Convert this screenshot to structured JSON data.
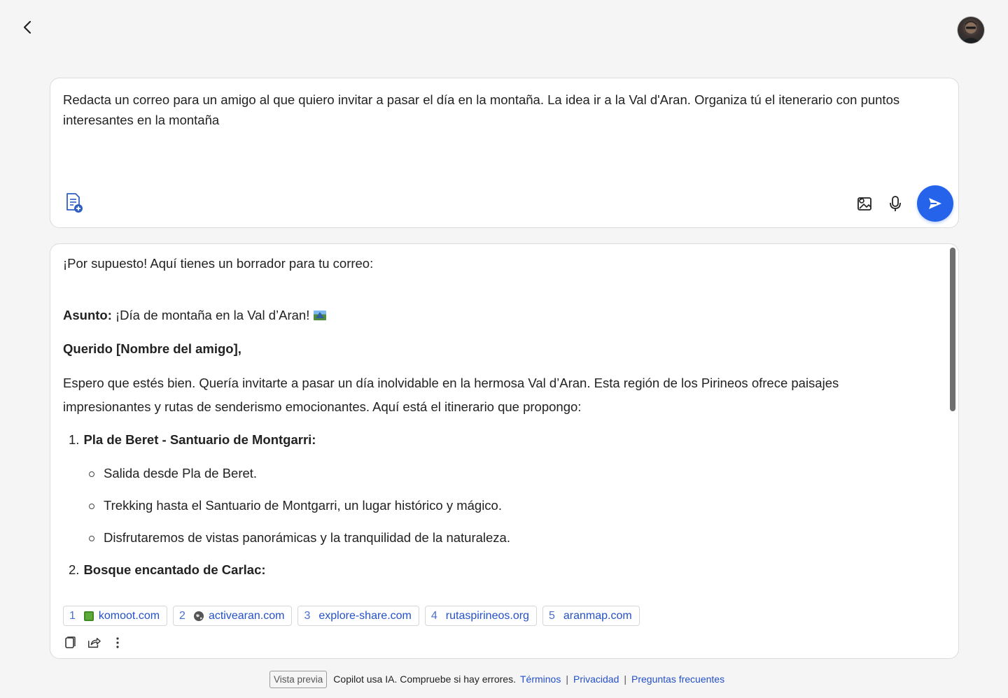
{
  "nav": {
    "back_icon": "chevron-left-icon",
    "avatar_icon": "user-avatar"
  },
  "prompt": {
    "text": "Redacta un correo para un amigo al que quiero invitar a pasar el día en la montaña. La idea ir a la Val d'Aran. Organiza tú el itenerario con puntos interesantes en la montaña",
    "send_color": "#2563eb"
  },
  "response": {
    "intro": "¡Por supuesto! Aquí tienes un borrador para tu correo:",
    "subject_label": "Asunto:",
    "subject_text": "¡Día de montaña en la Val d’Aran!",
    "subject_emoji": "mountain-landscape-emoji",
    "greeting": "Querido [Nombre del amigo],",
    "paragraph": "Espero que estés bien. Quería invitarte a pasar un día inolvidable en la hermosa Val d’Aran. Esta región de los Pirineos ofrece paisajes impresionantes y rutas de senderismo emocionantes. Aquí está el itinerario que propongo:",
    "items": [
      {
        "num": "1.",
        "title": "Pla de Beret - Santuario de Montgarri:",
        "bullets": [
          "Salida desde Pla de Beret.",
          "Trekking hasta el Santuario de Montgarri, un lugar histórico y mágico.",
          "Disfrutaremos de vistas panorámicas y la tranquilidad de la naturaleza."
        ]
      },
      {
        "num": "2.",
        "title": "Bosque encantado de Carlac:"
      }
    ]
  },
  "citations": [
    {
      "num": "1",
      "domain": "komoot.com",
      "icon_color": "#5fa83a"
    },
    {
      "num": "2",
      "domain": "activearan.com",
      "icon_color": "#555555"
    },
    {
      "num": "3",
      "domain": "explore-share.com",
      "icon_color": ""
    },
    {
      "num": "4",
      "domain": "rutaspirineos.org",
      "icon_color": ""
    },
    {
      "num": "5",
      "domain": "aranmap.com",
      "icon_color": ""
    }
  ],
  "footer": {
    "badge": "Vista previa",
    "text": "Copilot usa IA. Compruebe si hay errores.",
    "link_terms": "Términos",
    "sep": "|",
    "link_privacy": "Privacidad",
    "link_faq": "Preguntas frecuentes"
  }
}
